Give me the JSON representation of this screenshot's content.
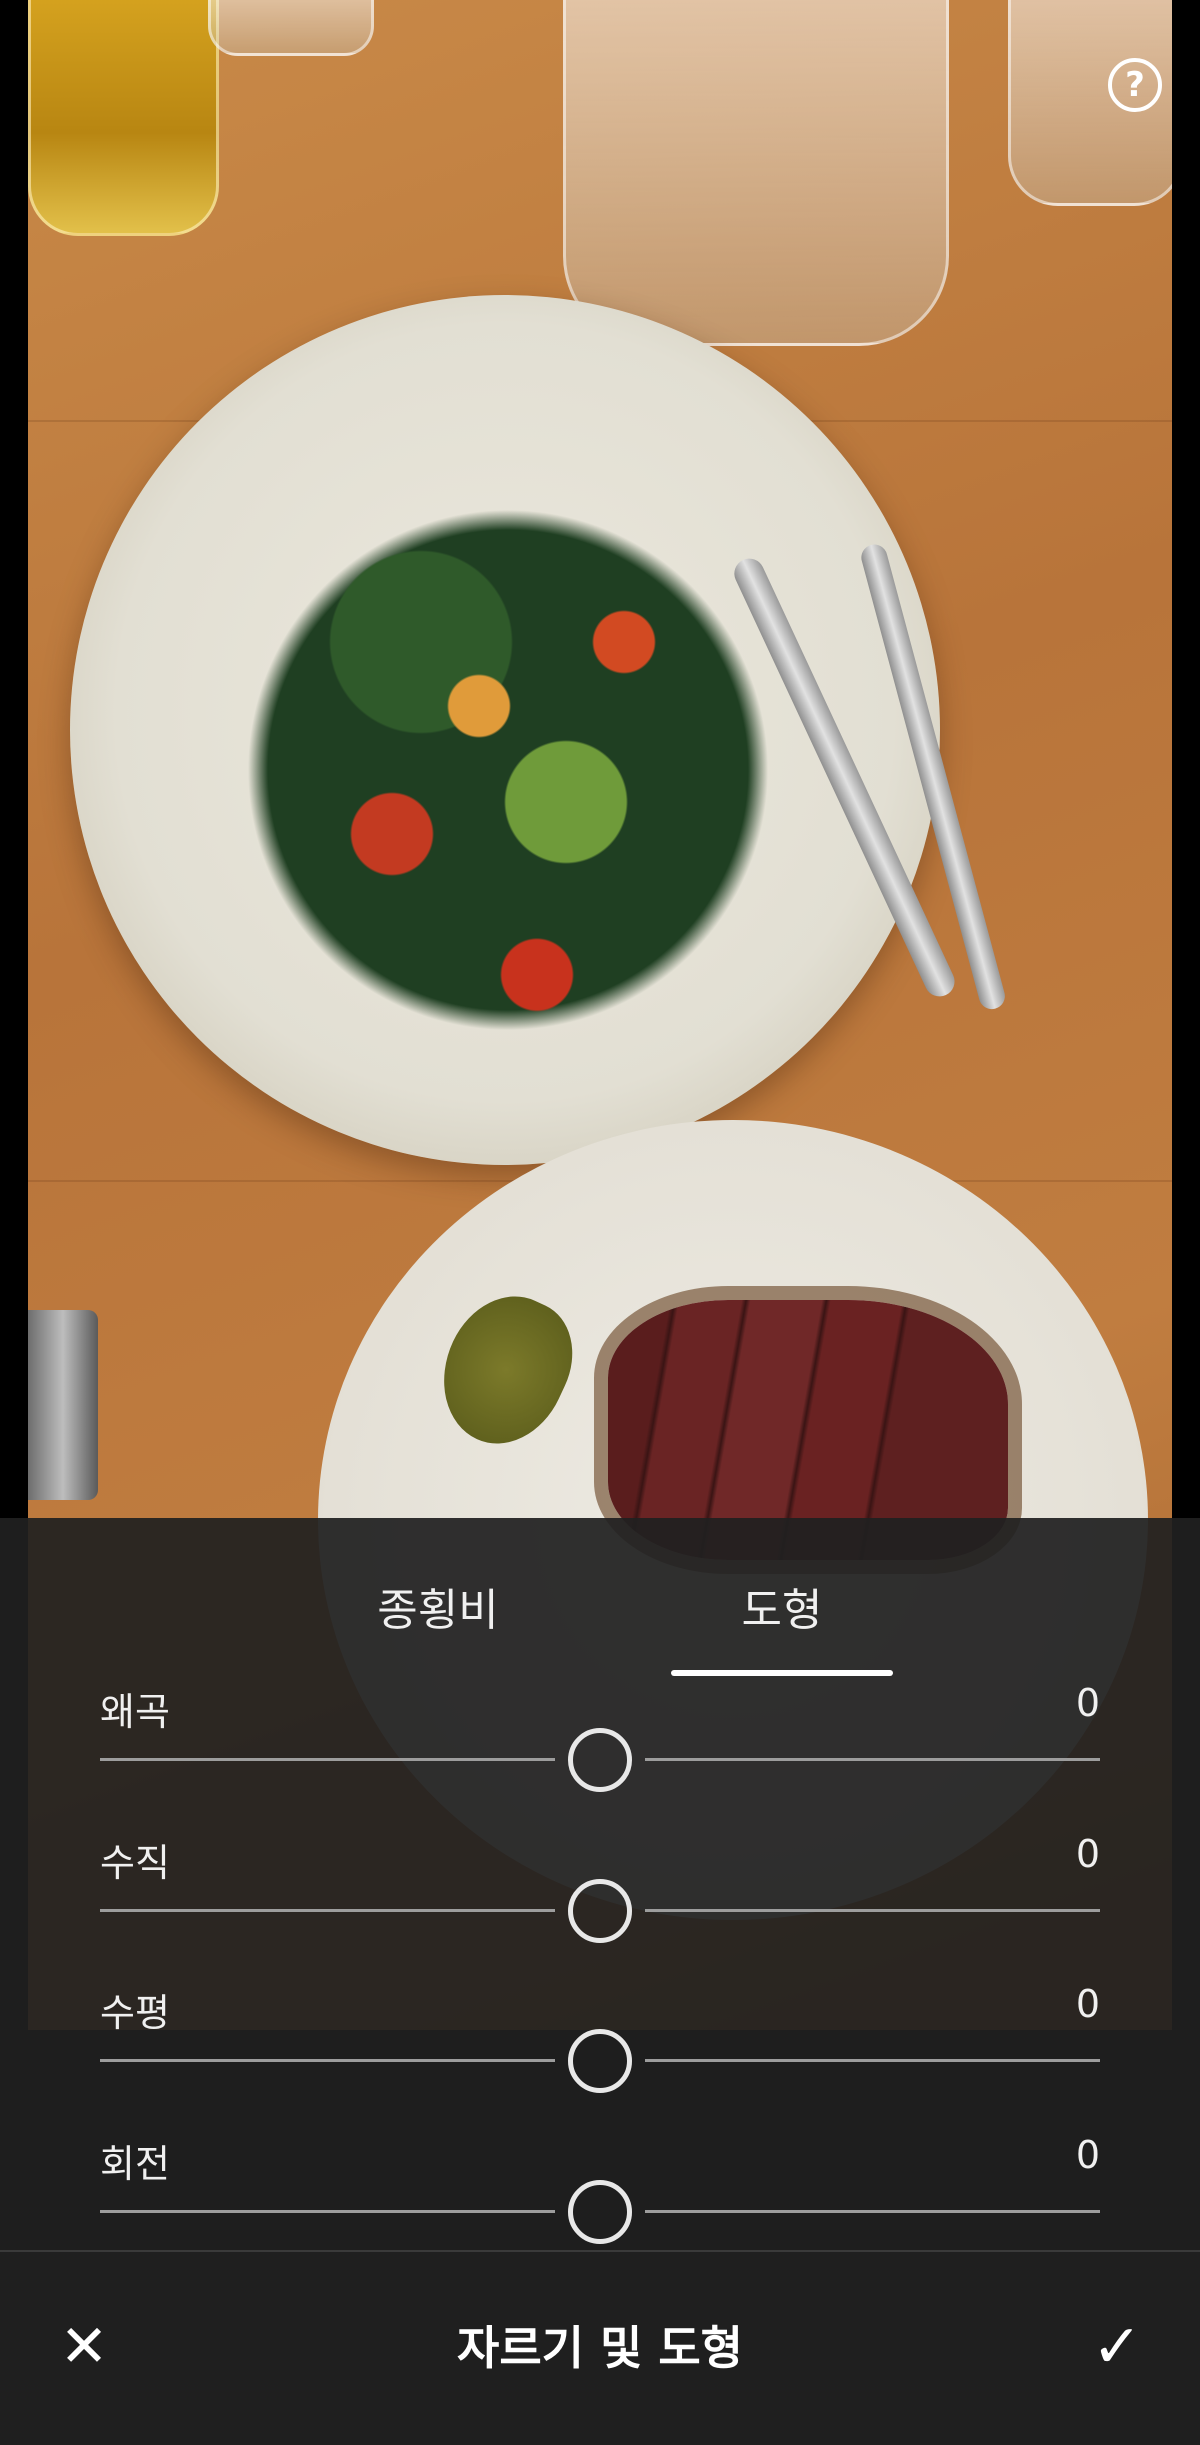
{
  "help_icon_text": "?",
  "tabs": [
    {
      "label": "종횡비",
      "selected": false
    },
    {
      "label": "도형",
      "selected": true
    }
  ],
  "sliders": [
    {
      "label": "왜곡",
      "value": "0"
    },
    {
      "label": "수직",
      "value": "0"
    },
    {
      "label": "수평",
      "value": "0"
    },
    {
      "label": "회전",
      "value": "0"
    }
  ],
  "bottombar": {
    "close_icon": "close-icon",
    "title": "자르기 및 도형",
    "apply_icon": "check-icon"
  },
  "colors": {
    "panel_bg": "#202020",
    "text": "#f0f0f0",
    "track": "#9d9d9d",
    "accent": "#ffffff"
  }
}
